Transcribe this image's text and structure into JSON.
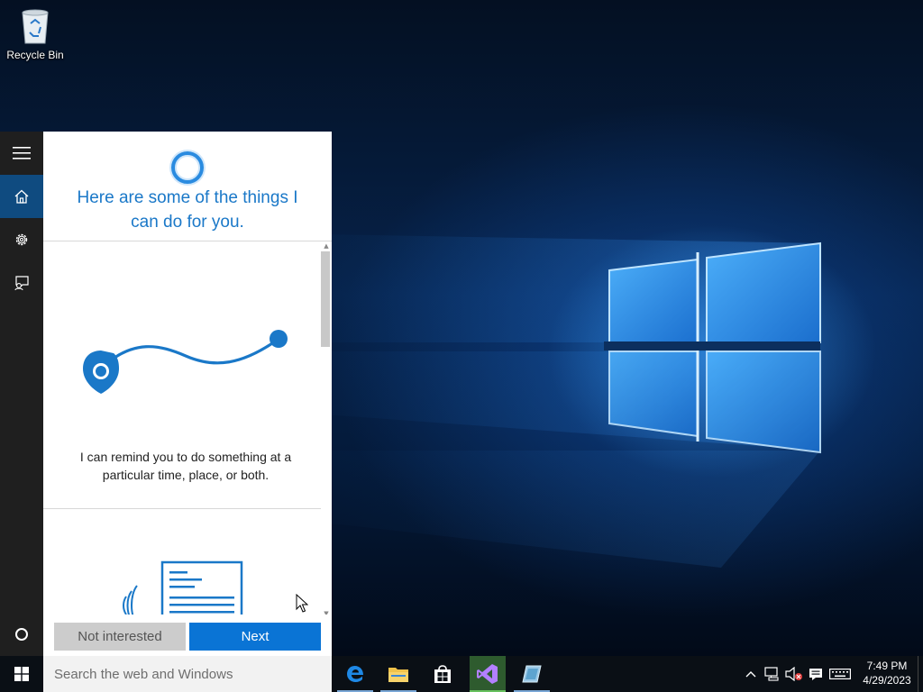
{
  "desktop": {
    "icons": [
      {
        "label": "Recycle Bin",
        "icon": "recycle-bin-icon"
      }
    ]
  },
  "cortana": {
    "rail": {
      "items": [
        {
          "name": "menu",
          "icon": "hamburger-menu-icon"
        },
        {
          "name": "home",
          "icon": "home-icon",
          "active": true
        },
        {
          "name": "settings",
          "icon": "gear-icon"
        },
        {
          "name": "feedback",
          "icon": "feedback-icon"
        },
        {
          "name": "cortana",
          "icon": "cortana-circle-icon"
        }
      ]
    },
    "title": "Here are some of the things I can do for you.",
    "cards": [
      {
        "icon": "reminder-path-icon",
        "text": "I can remind you to do something at a particular time, place, or both."
      },
      {
        "icon": "dictation-document-icon",
        "text": ""
      }
    ],
    "buttons": {
      "not_interested": "Not interested",
      "next": "Next"
    }
  },
  "taskbar": {
    "search_placeholder": "Search the web and Windows",
    "apps": [
      {
        "name": "Microsoft Edge",
        "icon": "edge-icon"
      },
      {
        "name": "File Explorer",
        "icon": "folder-icon"
      },
      {
        "name": "Store",
        "icon": "store-icon"
      },
      {
        "name": "Visual Studio",
        "icon": "visual-studio-icon",
        "active": true
      },
      {
        "name": "Unknown app",
        "icon": "app-icon"
      }
    ],
    "tray": {
      "icons": [
        "chevron-up-icon",
        "network-icon",
        "volume-muted-icon",
        "notifications-icon",
        "keyboard-icon"
      ],
      "time": "7:49 PM",
      "date": "4/29/2023"
    }
  },
  "colors": {
    "accent": "#0a74d5",
    "cortana_blue": "#1a78c8",
    "rail_active": "#0f4b80",
    "taskbar": "#0a0f15"
  }
}
